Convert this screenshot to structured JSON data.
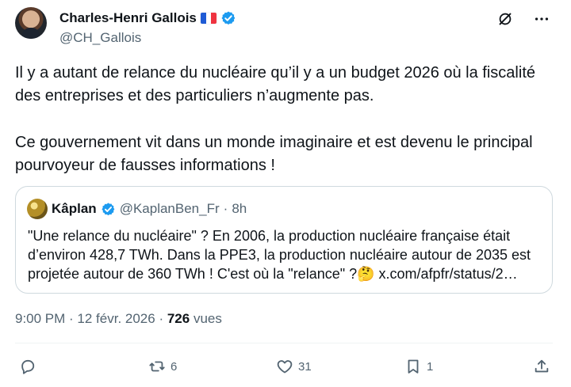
{
  "author": {
    "name": "Charles-Henri Gallois",
    "flag": "🇫🇷",
    "handle": "@CH_Gallois"
  },
  "tweet": {
    "paragraph_1": "Il y a autant de relance du nucléaire qu’il y a un budget 2026 où la fiscalité des entreprises et des particuliers n’augmente pas.",
    "paragraph_2": "Ce gouvernement vit dans un monde imaginaire et est devenu le principal pourvoyeur de fausses informations !"
  },
  "quote": {
    "name": "Kâplan",
    "handle": "@KaplanBen_Fr",
    "separator": "·",
    "time": "8h",
    "text": "\"Une relance du nucléaire\" ?  En 2006, la production nucléaire française était d’environ 428,7 TWh. Dans la PPE3, la production nucléaire autour de 2035 est projetée autour de 360 TWh ! C'est où la \"relance\" ?🤔 x.com/afpfr/status/2…"
  },
  "meta": {
    "timestamp": "9:00 PM · 12 févr. 2026 ·",
    "views_count": "726",
    "views_label": "vues"
  },
  "actions": {
    "replies": "",
    "reposts": "6",
    "likes": "31",
    "bookmarks": "1"
  },
  "colors": {
    "text": "#0f1419",
    "secondary": "#536471",
    "verified": "#1d9bf0",
    "border": "#cfd9de"
  }
}
